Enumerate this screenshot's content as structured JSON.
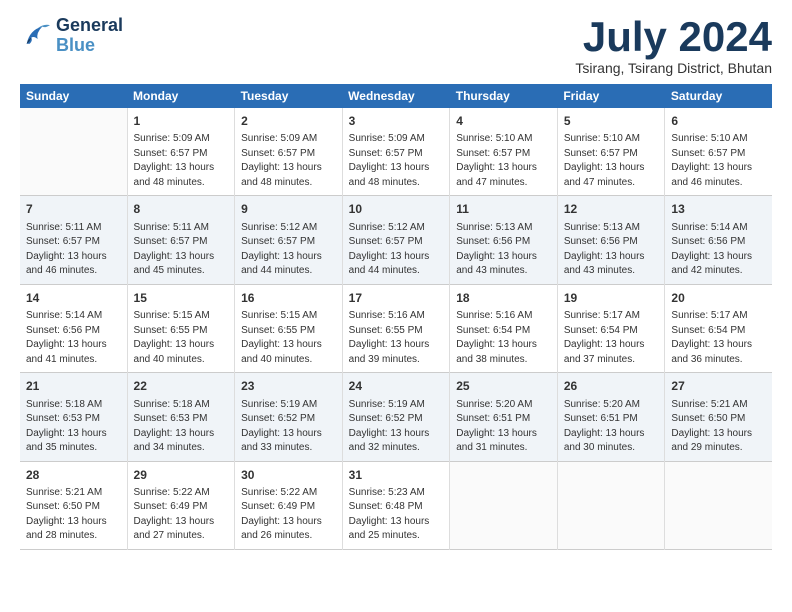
{
  "logo": {
    "line1": "General",
    "line2": "Blue"
  },
  "title": "July 2024",
  "subtitle": "Tsirang, Tsirang District, Bhutan",
  "header_days": [
    "Sunday",
    "Monday",
    "Tuesday",
    "Wednesday",
    "Thursday",
    "Friday",
    "Saturday"
  ],
  "weeks": [
    [
      {
        "num": "",
        "info": ""
      },
      {
        "num": "1",
        "info": "Sunrise: 5:09 AM\nSunset: 6:57 PM\nDaylight: 13 hours\nand 48 minutes."
      },
      {
        "num": "2",
        "info": "Sunrise: 5:09 AM\nSunset: 6:57 PM\nDaylight: 13 hours\nand 48 minutes."
      },
      {
        "num": "3",
        "info": "Sunrise: 5:09 AM\nSunset: 6:57 PM\nDaylight: 13 hours\nand 48 minutes."
      },
      {
        "num": "4",
        "info": "Sunrise: 5:10 AM\nSunset: 6:57 PM\nDaylight: 13 hours\nand 47 minutes."
      },
      {
        "num": "5",
        "info": "Sunrise: 5:10 AM\nSunset: 6:57 PM\nDaylight: 13 hours\nand 47 minutes."
      },
      {
        "num": "6",
        "info": "Sunrise: 5:10 AM\nSunset: 6:57 PM\nDaylight: 13 hours\nand 46 minutes."
      }
    ],
    [
      {
        "num": "7",
        "info": "Sunrise: 5:11 AM\nSunset: 6:57 PM\nDaylight: 13 hours\nand 46 minutes."
      },
      {
        "num": "8",
        "info": "Sunrise: 5:11 AM\nSunset: 6:57 PM\nDaylight: 13 hours\nand 45 minutes."
      },
      {
        "num": "9",
        "info": "Sunrise: 5:12 AM\nSunset: 6:57 PM\nDaylight: 13 hours\nand 44 minutes."
      },
      {
        "num": "10",
        "info": "Sunrise: 5:12 AM\nSunset: 6:57 PM\nDaylight: 13 hours\nand 44 minutes."
      },
      {
        "num": "11",
        "info": "Sunrise: 5:13 AM\nSunset: 6:56 PM\nDaylight: 13 hours\nand 43 minutes."
      },
      {
        "num": "12",
        "info": "Sunrise: 5:13 AM\nSunset: 6:56 PM\nDaylight: 13 hours\nand 43 minutes."
      },
      {
        "num": "13",
        "info": "Sunrise: 5:14 AM\nSunset: 6:56 PM\nDaylight: 13 hours\nand 42 minutes."
      }
    ],
    [
      {
        "num": "14",
        "info": "Sunrise: 5:14 AM\nSunset: 6:56 PM\nDaylight: 13 hours\nand 41 minutes."
      },
      {
        "num": "15",
        "info": "Sunrise: 5:15 AM\nSunset: 6:55 PM\nDaylight: 13 hours\nand 40 minutes."
      },
      {
        "num": "16",
        "info": "Sunrise: 5:15 AM\nSunset: 6:55 PM\nDaylight: 13 hours\nand 40 minutes."
      },
      {
        "num": "17",
        "info": "Sunrise: 5:16 AM\nSunset: 6:55 PM\nDaylight: 13 hours\nand 39 minutes."
      },
      {
        "num": "18",
        "info": "Sunrise: 5:16 AM\nSunset: 6:54 PM\nDaylight: 13 hours\nand 38 minutes."
      },
      {
        "num": "19",
        "info": "Sunrise: 5:17 AM\nSunset: 6:54 PM\nDaylight: 13 hours\nand 37 minutes."
      },
      {
        "num": "20",
        "info": "Sunrise: 5:17 AM\nSunset: 6:54 PM\nDaylight: 13 hours\nand 36 minutes."
      }
    ],
    [
      {
        "num": "21",
        "info": "Sunrise: 5:18 AM\nSunset: 6:53 PM\nDaylight: 13 hours\nand 35 minutes."
      },
      {
        "num": "22",
        "info": "Sunrise: 5:18 AM\nSunset: 6:53 PM\nDaylight: 13 hours\nand 34 minutes."
      },
      {
        "num": "23",
        "info": "Sunrise: 5:19 AM\nSunset: 6:52 PM\nDaylight: 13 hours\nand 33 minutes."
      },
      {
        "num": "24",
        "info": "Sunrise: 5:19 AM\nSunset: 6:52 PM\nDaylight: 13 hours\nand 32 minutes."
      },
      {
        "num": "25",
        "info": "Sunrise: 5:20 AM\nSunset: 6:51 PM\nDaylight: 13 hours\nand 31 minutes."
      },
      {
        "num": "26",
        "info": "Sunrise: 5:20 AM\nSunset: 6:51 PM\nDaylight: 13 hours\nand 30 minutes."
      },
      {
        "num": "27",
        "info": "Sunrise: 5:21 AM\nSunset: 6:50 PM\nDaylight: 13 hours\nand 29 minutes."
      }
    ],
    [
      {
        "num": "28",
        "info": "Sunrise: 5:21 AM\nSunset: 6:50 PM\nDaylight: 13 hours\nand 28 minutes."
      },
      {
        "num": "29",
        "info": "Sunrise: 5:22 AM\nSunset: 6:49 PM\nDaylight: 13 hours\nand 27 minutes."
      },
      {
        "num": "30",
        "info": "Sunrise: 5:22 AM\nSunset: 6:49 PM\nDaylight: 13 hours\nand 26 minutes."
      },
      {
        "num": "31",
        "info": "Sunrise: 5:23 AM\nSunset: 6:48 PM\nDaylight: 13 hours\nand 25 minutes."
      },
      {
        "num": "",
        "info": ""
      },
      {
        "num": "",
        "info": ""
      },
      {
        "num": "",
        "info": ""
      }
    ]
  ]
}
